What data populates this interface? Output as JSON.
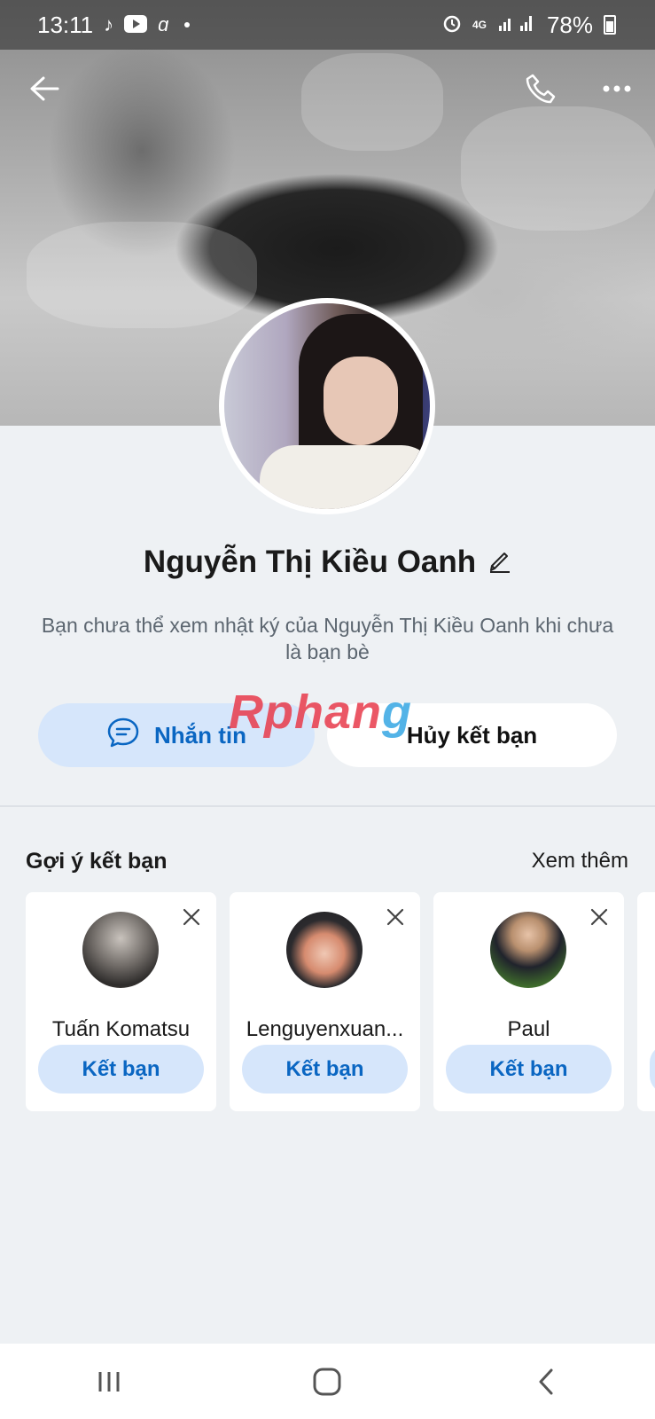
{
  "status_bar": {
    "time": "13:11",
    "network": "4G",
    "battery": "78%",
    "icons": [
      "tiktok-icon",
      "youtube-icon",
      "messenger-icon",
      "alarm-icon",
      "signal-icon",
      "battery-icon"
    ]
  },
  "header": {
    "back_icon": "back-arrow-icon",
    "call_icon": "phone-icon",
    "more_icon": "more-icon"
  },
  "profile": {
    "name": "Nguyễn Thị Kiều Oanh",
    "edit_icon": "pencil-icon",
    "notice": "Bạn chưa thể xem nhật ký của Nguyễn Thị Kiều Oanh khi chưa là bạn bè"
  },
  "actions": {
    "message_label": "Nhắn tin",
    "unfriend_label": "Hủy kết bạn"
  },
  "watermark": {
    "part1": "Rphan",
    "part2": "g"
  },
  "suggestions": {
    "title": "Gợi ý kết bạn",
    "more_label": "Xem thêm",
    "items": [
      {
        "name": "Tuấn Komatsu",
        "button": "Kết bạn"
      },
      {
        "name": "Lenguyenxuan...",
        "button": "Kết bạn"
      },
      {
        "name": "Paul",
        "button": "Kết bạn"
      }
    ]
  },
  "colors": {
    "accent": "#0a66c2",
    "button_bg": "#d6e6fb",
    "page_bg": "#eef1f4"
  }
}
